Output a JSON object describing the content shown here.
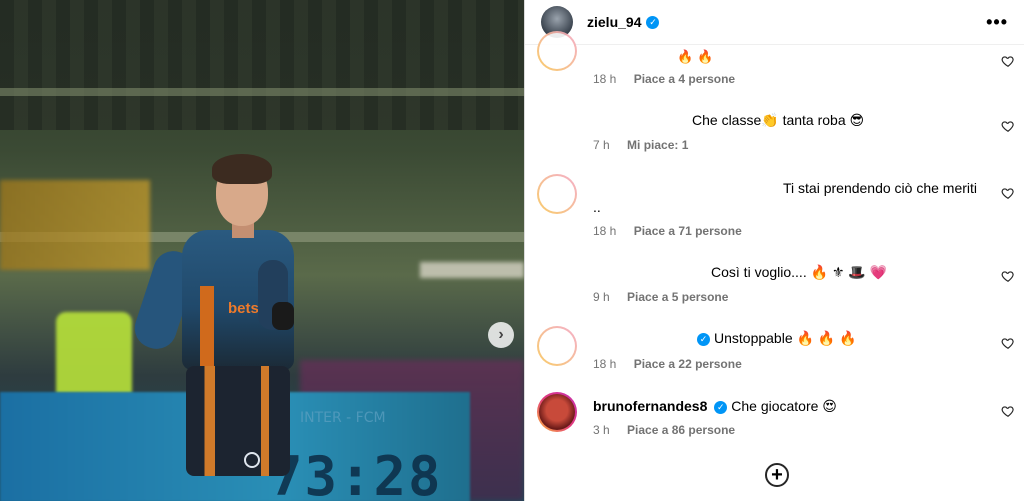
{
  "post": {
    "next_icon": "chevron-right-icon",
    "scoreboard": {
      "clock": "73:28",
      "label": "INTER - FCM"
    },
    "jersey_sponsor": "betsson"
  },
  "header": {
    "username": "zielu_94",
    "verified": true,
    "more_icon": "more-horizontal-icon",
    "more_label": "•••"
  },
  "comments": [
    {
      "user": "",
      "text": "🔥 🔥",
      "time": "18 h",
      "likes": "Piace a 4 persone"
    },
    {
      "user": "",
      "text": "Che classe👏 tanta roba 😎",
      "time": "7 h",
      "likes": "Mi piace: 1"
    },
    {
      "user": "",
      "text": "Ti stai prendendo ciò che meriti",
      "text2": "..",
      "time": "18 h",
      "likes": "Piace a 71 persone"
    },
    {
      "user": "",
      "text": "Così ti voglio.... 🔥 ⚜ 🎩 💗",
      "time": "9 h",
      "likes": "Piace a 5 persone"
    },
    {
      "user": "",
      "text": "Unstoppable 🔥 🔥 🔥",
      "time": "18 h",
      "likes": "Piace a 22 persone"
    },
    {
      "user": "brunofernandes8",
      "text": "Che giocatore 😍",
      "time": "3 h",
      "likes": "Piace a 86 persone"
    }
  ],
  "add_comment_icon": "plus-circle-icon",
  "colors": {
    "verified": "#0095f6",
    "meta": "#737373",
    "story_ring_start": "#f9b33a",
    "story_ring_end": "#c32fb0"
  }
}
